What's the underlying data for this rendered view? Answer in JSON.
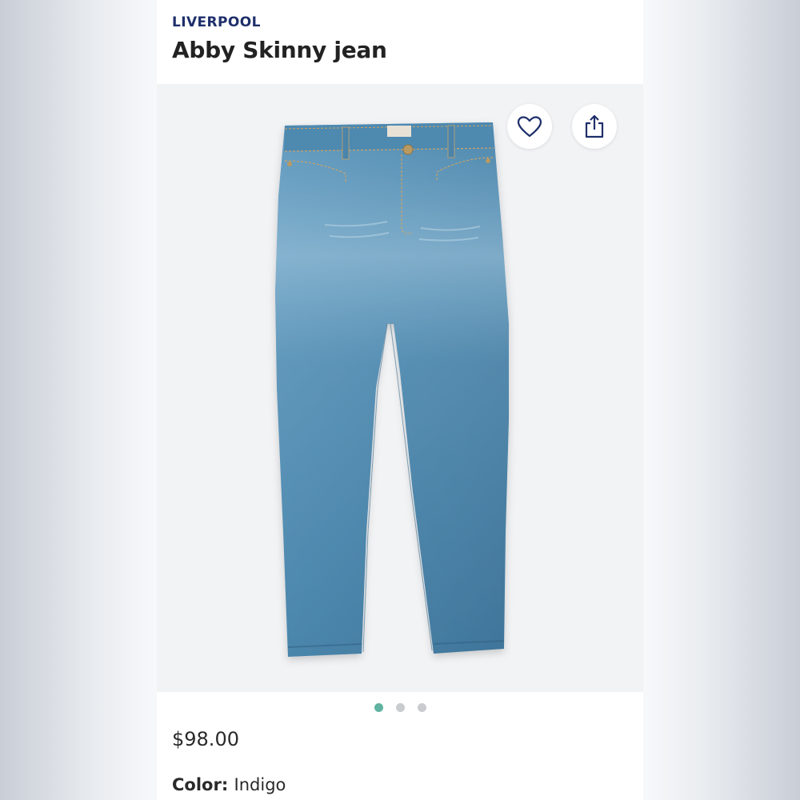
{
  "product": {
    "brand": "LIVERPOOL",
    "name": "Abby Skinny jean",
    "price": "$98.00",
    "color_label": "Color:",
    "color_value": "Indigo"
  },
  "gallery": {
    "image_alt": "Abby Skinny jean",
    "total_images": 3,
    "active_index": 0
  },
  "actions": {
    "favorite_icon": "heart-icon",
    "share_icon": "share-icon"
  },
  "colors": {
    "brand_text": "#1f2f6b",
    "active_dot": "#5fb3a0",
    "inactive_dot": "#c9cbcf",
    "denim": "#4a86ad"
  }
}
